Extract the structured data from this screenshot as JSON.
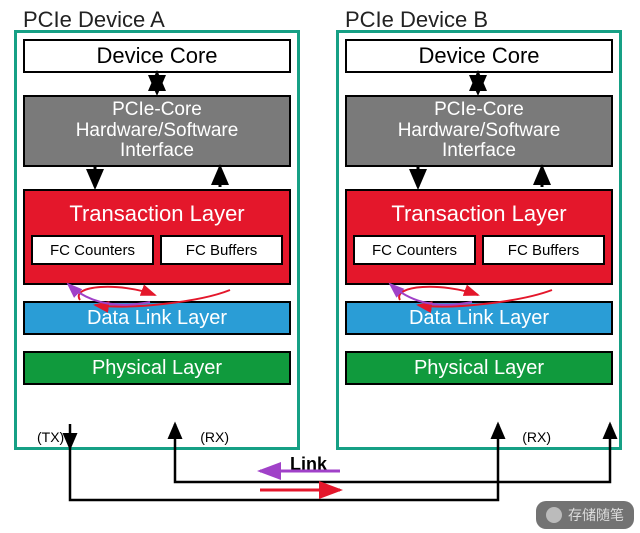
{
  "devices": {
    "a": {
      "title": "PCIe Device A"
    },
    "b": {
      "title": "PCIe Device B"
    }
  },
  "layers": {
    "core": "Device Core",
    "interface_line1": "PCIe-Core",
    "interface_line2": "Hardware/Software",
    "interface_line3": "Interface",
    "transaction": "Transaction Layer",
    "fc_counters": "FC Counters",
    "fc_buffers": "FC Buffers",
    "datalink": "Data Link Layer",
    "physical": "Physical Layer"
  },
  "labels": {
    "tx": "(TX)",
    "rx": "(RX)",
    "link": "Link"
  },
  "colors": {
    "device_border": "#16a085",
    "interface_bg": "#7a7a7a",
    "transaction_bg": "#e4172b",
    "datalink_bg": "#2a9dd6",
    "physical_bg": "#109a3d",
    "link_purple": "#a041c8",
    "link_red": "#e4172b"
  },
  "watermark": "存储随笔"
}
